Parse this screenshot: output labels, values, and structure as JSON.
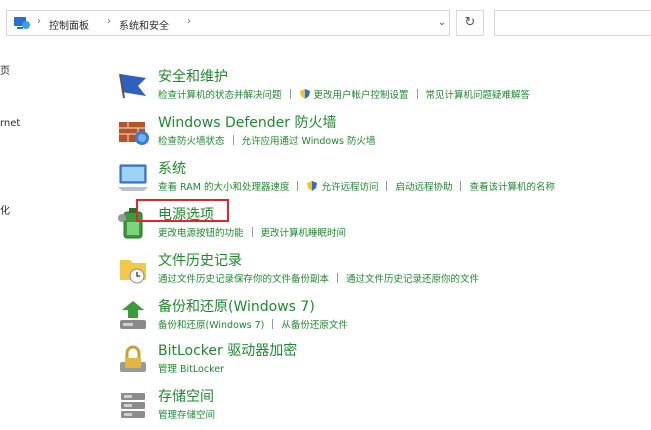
{
  "address_bar": {
    "breadcrumbs": [
      "控制面板",
      "系统和安全"
    ]
  },
  "left_nav_fragments": [
    "页",
    "rnet",
    "化"
  ],
  "sections": [
    {
      "title": "安全和维护",
      "icon": "security-flag-icon",
      "links": [
        "检查计算机的状态并解决问题",
        "更改用户帐户控制设置",
        "常见计算机问题疑难解答"
      ]
    },
    {
      "title": "Windows Defender 防火墙",
      "icon": "firewall-icon",
      "links": [
        "检查防火墙状态",
        "允许应用通过 Windows 防火墙"
      ]
    },
    {
      "title": "系统",
      "icon": "system-computer-icon",
      "links": [
        "查看 RAM 的大小和处理器速度",
        "允许远程访问",
        "启动远程协助",
        "查看该计算机的名称"
      ]
    },
    {
      "title": "电源选项",
      "icon": "power-battery-icon",
      "links": [
        "更改电源按钮的功能",
        "更改计算机睡眠时间"
      ]
    },
    {
      "title": "文件历史记录",
      "icon": "file-history-icon",
      "links": [
        "通过文件历史记录保存你的文件备份副本",
        "通过文件历史记录还原你的文件"
      ]
    },
    {
      "title": "备份和还原(Windows 7)",
      "icon": "backup-restore-icon",
      "links": [
        "备份和还原(Windows 7)",
        "从备份还原文件"
      ]
    },
    {
      "title": "BitLocker 驱动器加密",
      "icon": "bitlocker-icon",
      "links": [
        "管理 BitLocker"
      ]
    },
    {
      "title": "存储空间",
      "icon": "storage-spaces-icon",
      "links": [
        "管理存储空间"
      ]
    }
  ],
  "colors": {
    "link_green": "#1e8a2e",
    "highlight_red": "#e0262b"
  }
}
